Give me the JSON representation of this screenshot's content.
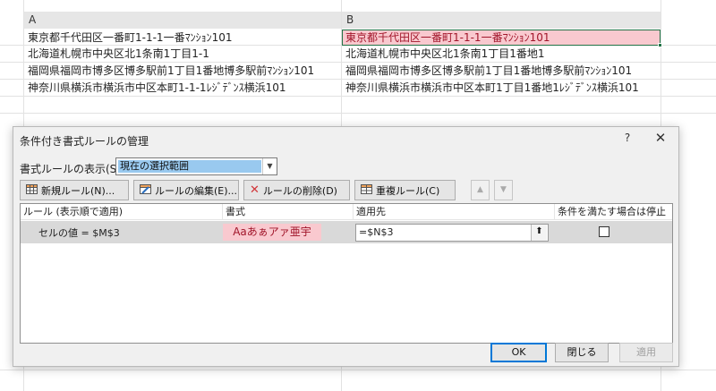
{
  "sheet": {
    "columns": [
      "A",
      "B"
    ],
    "rows": [
      {
        "a": "東京都千代田区一番町1-1-1一番ﾏﾝｼｮﾝ101",
        "b": "東京都千代田区一番町1-1-1一番ﾏﾝｼｮﾝ101"
      },
      {
        "a": "北海道札幌市中央区北1条南1丁目1-1",
        "b": "北海道札幌市中央区北1条南1丁目1番地1"
      },
      {
        "a": "福岡県福岡市博多区博多駅前1丁目1番地博多駅前ﾏﾝｼｮﾝ101",
        "b": "福岡県福岡市博多区博多駅前1丁目1番地博多駅前ﾏﾝｼｮﾝ101"
      },
      {
        "a": "神奈川県横浜市横浜市中区本町1-1-1ﾚｼﾞﾃﾞﾝｽ横浜101",
        "b": "神奈川県横浜市横浜市中区本町1丁目1番地1ﾚｼﾞﾃﾞﾝｽ横浜101"
      }
    ],
    "highlight_color": "#f9c9cf",
    "highlight_text_color": "#a1152a"
  },
  "dialog": {
    "title": "条件付き書式ルールの管理",
    "help": "?",
    "close": "✕",
    "show_label": "書式ルールの表示(S):",
    "show_value": "現在の選択範囲",
    "toolbar": {
      "new_rule": "新規ルール(N)...",
      "edit_rule": "ルールの編集(E)...",
      "delete_rule": "ルールの削除(D)",
      "duplicate_rule": "重複ルール(C)",
      "move_up": "▲",
      "move_down": "▼"
    },
    "table": {
      "headers": [
        "ルール (表示順で適用)",
        "書式",
        "適用先",
        "条件を満たす場合は停止"
      ],
      "rows": [
        {
          "rule": "セルの値 = $M$3",
          "format_preview": "Aaあぁアァ亜宇",
          "applies_to": "=$N$3",
          "stop_if_true": false
        }
      ]
    },
    "buttons": {
      "ok": "OK",
      "close": "閉じる",
      "apply": "適用"
    }
  }
}
